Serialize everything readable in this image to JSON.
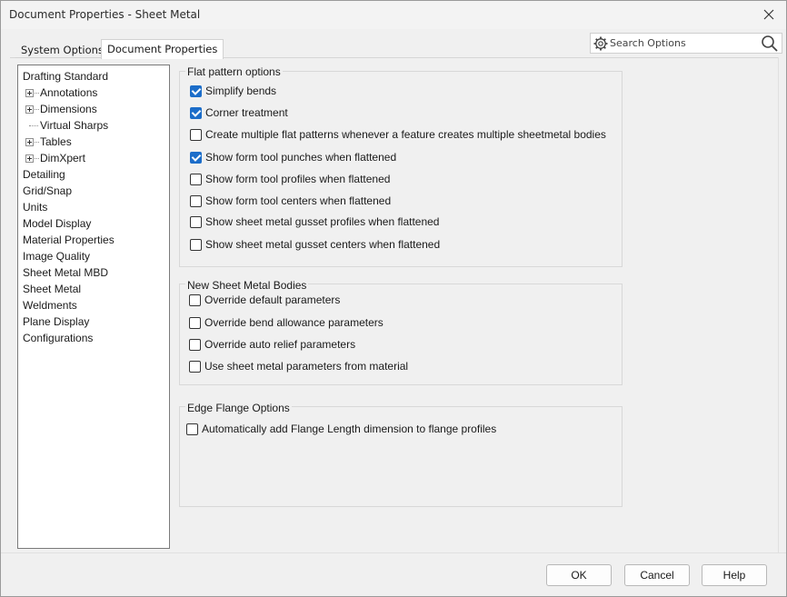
{
  "window": {
    "title": "Document Properties - Sheet Metal",
    "close_icon": "close-icon"
  },
  "tabs": [
    {
      "label": "System Options",
      "active": false
    },
    {
      "label": "Document Properties",
      "active": true
    }
  ],
  "search": {
    "placeholder": "Search Options",
    "value": "",
    "icons": [
      "gear-icon",
      "search-icon"
    ]
  },
  "tree": {
    "items": [
      {
        "label": "Drafting Standard",
        "level": 0,
        "expandable": false
      },
      {
        "label": "Annotations",
        "level": 1,
        "expandable": true
      },
      {
        "label": "Dimensions",
        "level": 1,
        "expandable": true
      },
      {
        "label": "Virtual Sharps",
        "level": 1,
        "expandable": false
      },
      {
        "label": "Tables",
        "level": 1,
        "expandable": true
      },
      {
        "label": "DimXpert",
        "level": 1,
        "expandable": true
      },
      {
        "label": "Detailing",
        "level": 0,
        "expandable": false
      },
      {
        "label": "Grid/Snap",
        "level": 0,
        "expandable": false
      },
      {
        "label": "Units",
        "level": 0,
        "expandable": false
      },
      {
        "label": "Model Display",
        "level": 0,
        "expandable": false
      },
      {
        "label": "Material Properties",
        "level": 0,
        "expandable": false
      },
      {
        "label": "Image Quality",
        "level": 0,
        "expandable": false
      },
      {
        "label": "Sheet Metal MBD",
        "level": 0,
        "expandable": false
      },
      {
        "label": "Sheet Metal",
        "level": 0,
        "expandable": false,
        "selected": true
      },
      {
        "label": "Weldments",
        "level": 0,
        "expandable": false
      },
      {
        "label": "Plane Display",
        "level": 0,
        "expandable": false
      },
      {
        "label": "Configurations",
        "level": 0,
        "expandable": false
      }
    ]
  },
  "flat_pattern": {
    "title": "Flat pattern options",
    "options": [
      {
        "label": "Simplify bends",
        "checked": true
      },
      {
        "label": "Corner treatment",
        "checked": true
      },
      {
        "label": "Create multiple flat patterns whenever a feature creates multiple sheetmetal bodies",
        "checked": false
      },
      {
        "label": "Show form tool punches when flattened",
        "checked": true
      },
      {
        "label": "Show form tool profiles when flattened",
        "checked": false
      },
      {
        "label": "Show form tool centers when flattened",
        "checked": false
      },
      {
        "label": "Show sheet metal gusset profiles when flattened",
        "checked": false
      },
      {
        "label": "Show sheet metal gusset centers when flattened",
        "checked": false
      }
    ]
  },
  "new_bodies": {
    "title": "New Sheet Metal Bodies",
    "options": [
      {
        "label": "Override default parameters",
        "checked": false
      },
      {
        "label": "Override bend allowance parameters",
        "checked": false
      },
      {
        "label": "Override auto relief parameters",
        "checked": false
      },
      {
        "label": "Use sheet metal parameters from material",
        "checked": false
      }
    ]
  },
  "edge_flange": {
    "title": "Edge Flange Options",
    "options": [
      {
        "label": "Automatically add Flange Length dimension to flange profiles",
        "checked": false
      }
    ]
  },
  "buttons": {
    "ok": "OK",
    "cancel": "Cancel",
    "help": "Help"
  }
}
